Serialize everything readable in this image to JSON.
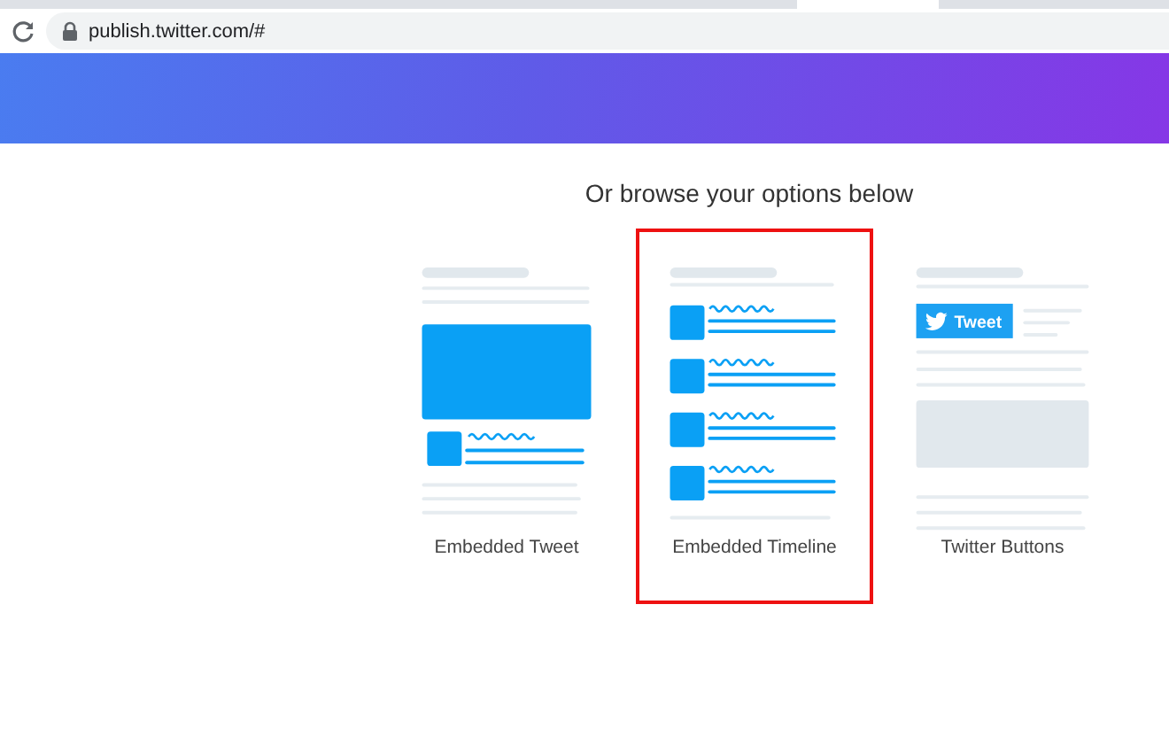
{
  "browser": {
    "url": "publish.twitter.com/#"
  },
  "heading": "Or browse your options below",
  "options": [
    {
      "kind": "tweet",
      "label": "Embedded Tweet",
      "selected": false
    },
    {
      "kind": "timeline",
      "label": "Embedded Timeline",
      "selected": true
    },
    {
      "kind": "buttons",
      "label": "Twitter Buttons",
      "selected": false,
      "button_label": "Tweet"
    }
  ]
}
